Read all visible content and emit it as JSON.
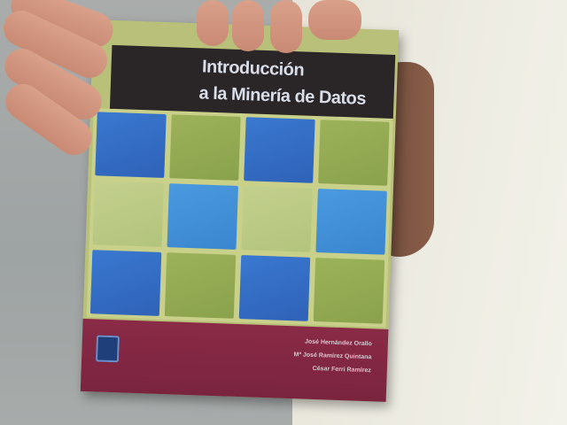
{
  "book": {
    "title_line1": "Introducción",
    "title_line2": "a la Minería de Datos",
    "authors": [
      "José Hernández Orallo",
      "Mª José Ramírez Quintana",
      "César Ferri Ramírez"
    ],
    "publisher_logo": "publisher-logo-icon"
  },
  "colors": {
    "title_band": "#2a2628",
    "bottom_band": "#7a2440",
    "tile_blue": "#3a78d0",
    "tile_green": "#9cb25a"
  }
}
